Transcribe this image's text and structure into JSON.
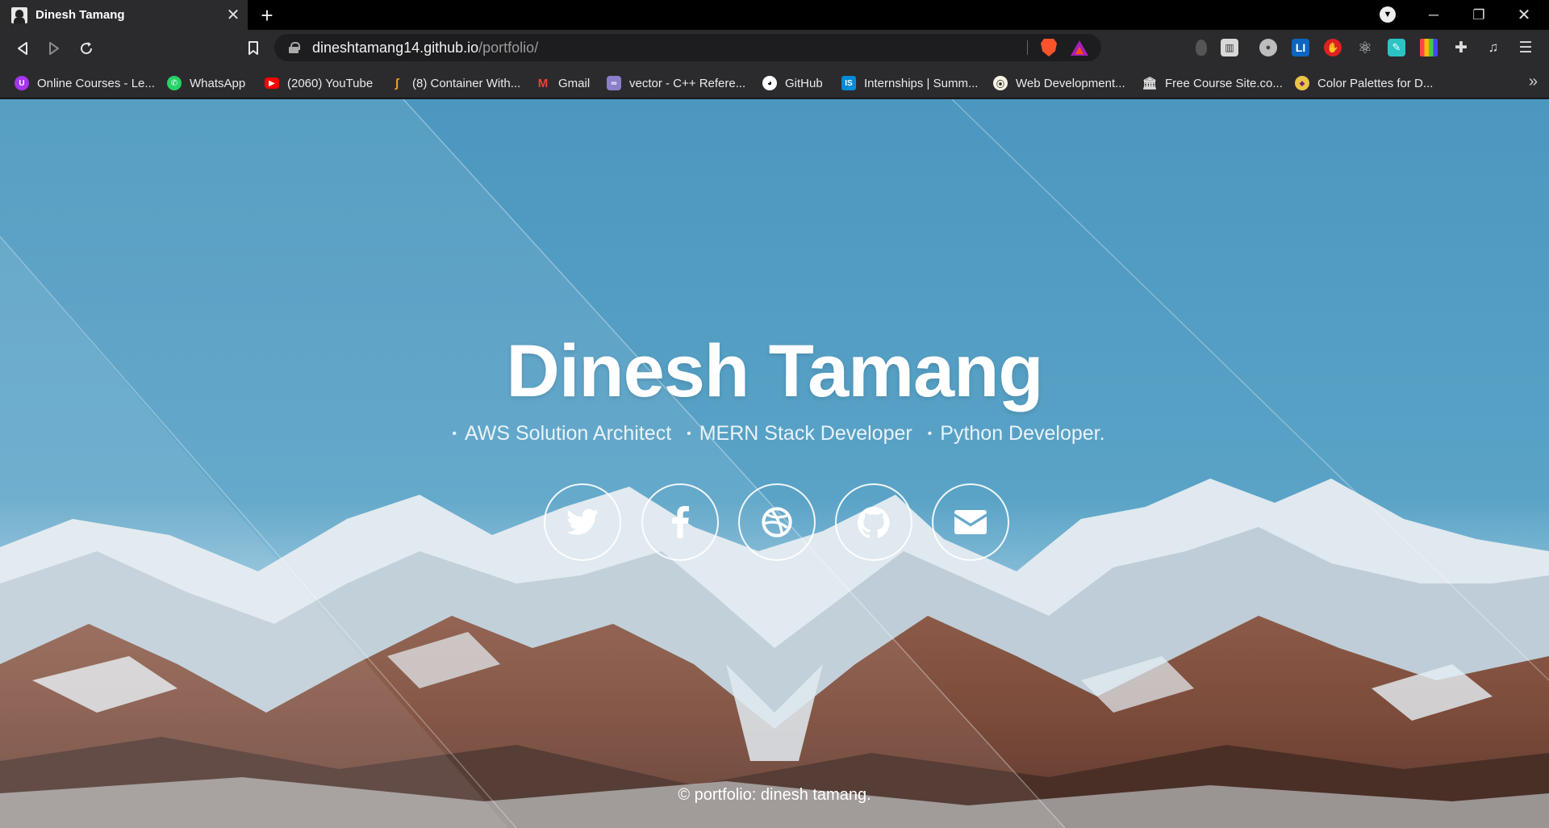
{
  "tab": {
    "title": "Dinesh Tamang"
  },
  "address_bar": {
    "host": "dineshtamang14.github.io",
    "path": "/portfolio/"
  },
  "bookmarks": [
    {
      "label": "Online Courses - Le...",
      "icon": "udemy-icon",
      "color": "#a435f0"
    },
    {
      "label": "WhatsApp",
      "icon": "whatsapp-icon",
      "color": "#25d366"
    },
    {
      "label": "(2060) YouTube",
      "icon": "youtube-icon",
      "color": "#ff0000"
    },
    {
      "label": "(8) Container With...",
      "icon": "leetcode-icon",
      "color": "#f89f1b"
    },
    {
      "label": "Gmail",
      "icon": "gmail-icon",
      "color": "#ea4335"
    },
    {
      "label": "vector - C++ Refere...",
      "icon": "cpp-reference-icon",
      "color": "#8a7fc8"
    },
    {
      "label": "GitHub",
      "icon": "github-icon",
      "color": "#ffffff"
    },
    {
      "label": "Internships | Summ...",
      "icon": "internshala-icon",
      "color": "#008bdc"
    },
    {
      "label": "Web Development...",
      "icon": "web-dev-icon",
      "color": "#f7c948"
    },
    {
      "label": "Free Course Site.co...",
      "icon": "course-site-icon",
      "color": "#dddddd"
    },
    {
      "label": "Color Palettes for D...",
      "icon": "palette-icon",
      "color": "#e8c547"
    }
  ],
  "hero": {
    "name": "Dinesh Tamang",
    "roles": [
      "AWS Solution Architect",
      "MERN Stack Developer",
      "Python Developer."
    ],
    "socials": [
      "twitter-icon",
      "facebook-icon",
      "dribbble-icon",
      "github-icon",
      "email-icon"
    ]
  },
  "footer": {
    "text": "© portfolio: dinesh tamang."
  },
  "colors": {
    "sky": "#4f9bc1",
    "accent_text": "#ffffff",
    "brave": "#fb542b",
    "bat": "#a61fb5"
  }
}
